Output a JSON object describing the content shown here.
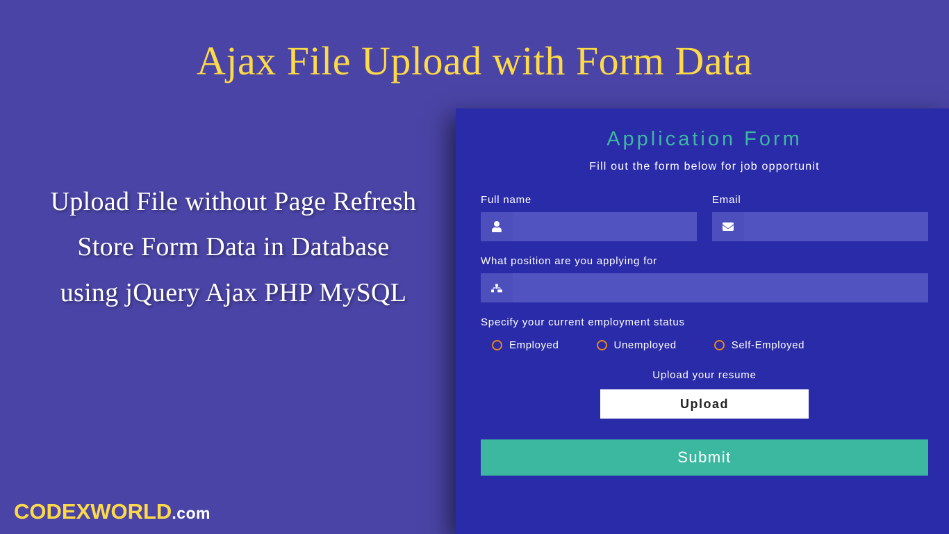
{
  "header": {
    "title": "Ajax File Upload with Form Data"
  },
  "subtext": {
    "line1": "Upload File without Page Refresh",
    "line2": "Store Form Data in Database",
    "line3": "using jQuery Ajax PHP MySQL"
  },
  "brand": {
    "name": "CODEXWORLD",
    "suffix": ".com"
  },
  "form": {
    "title": "Application Form",
    "description": "Fill out the form below for job opportunit",
    "fullname_label": "Full name",
    "email_label": "Email",
    "position_label": "What position are you applying for",
    "status_label": "Specify your current employment status",
    "radios": {
      "employed": "Employed",
      "unemployed": "Unemployed",
      "self": "Self-Employed"
    },
    "upload_label": "Upload your resume",
    "upload_button": "Upload",
    "submit_label": "Submit"
  }
}
